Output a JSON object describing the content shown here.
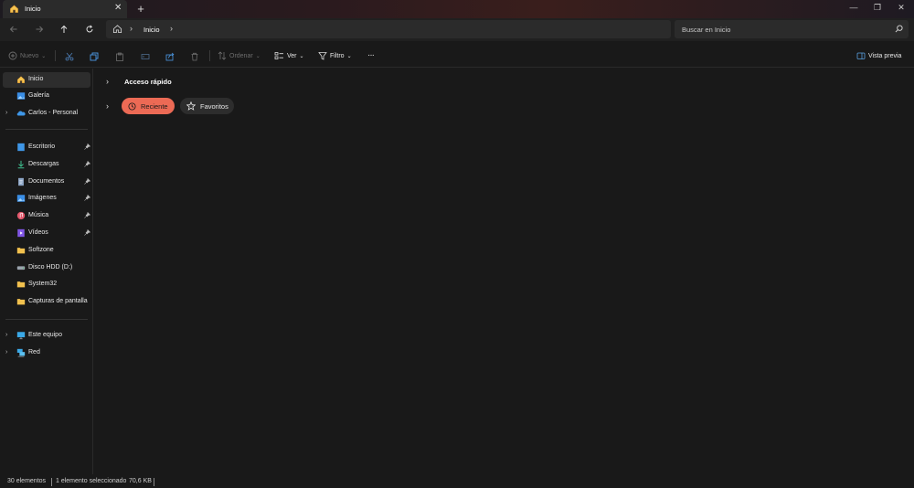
{
  "tab": {
    "title": "Inicio",
    "close": "✕",
    "new_tab": "+"
  },
  "window": {
    "minimize": "—",
    "restore": "❐",
    "close": "✕"
  },
  "address": {
    "crumb": "Inicio",
    "separator": "›",
    "trailing": "›"
  },
  "search": {
    "placeholder": "Buscar en Inicio"
  },
  "toolbar": {
    "new_label": "Nuevo",
    "sort_label": "Ordenar",
    "view_label": "Ver",
    "filter_label": "Filtro",
    "more": "···",
    "preview_label": "Vista previa"
  },
  "sidebar": {
    "items": [
      {
        "label": "Inicio",
        "icon": "home-icon"
      },
      {
        "label": "Galería",
        "icon": "gallery-icon"
      },
      {
        "label": "Carlos - Personal",
        "icon": "onedrive-icon"
      },
      {
        "label": "Escritorio",
        "icon": "desktop-icon"
      },
      {
        "label": "Descargas",
        "icon": "downloads-icon"
      },
      {
        "label": "Documentos",
        "icon": "documents-icon"
      },
      {
        "label": "Imágenes",
        "icon": "pictures-icon"
      },
      {
        "label": "Música",
        "icon": "music-icon"
      },
      {
        "label": "Vídeos",
        "icon": "videos-icon"
      },
      {
        "label": "Softzone",
        "icon": "folder-icon"
      },
      {
        "label": "Disco HDD (D:)",
        "icon": "drive-icon"
      },
      {
        "label": "System32",
        "icon": "folder-icon"
      },
      {
        "label": "Capturas de pantalla",
        "icon": "folder-icon"
      },
      {
        "label": "Este equipo",
        "icon": "computer-icon"
      },
      {
        "label": "Red",
        "icon": "network-icon"
      }
    ]
  },
  "main": {
    "quick_access_title": "Acceso rápido",
    "pills": [
      {
        "label": "Reciente",
        "active": true
      },
      {
        "label": "Favoritos",
        "active": false
      }
    ]
  },
  "status": {
    "count": "30 elementos",
    "selection": "1 elemento seleccionado",
    "size": "70,6 KB"
  },
  "colors": {
    "accent": "#ec6a55",
    "background": "#191919",
    "panel": "#2b2b2b"
  }
}
